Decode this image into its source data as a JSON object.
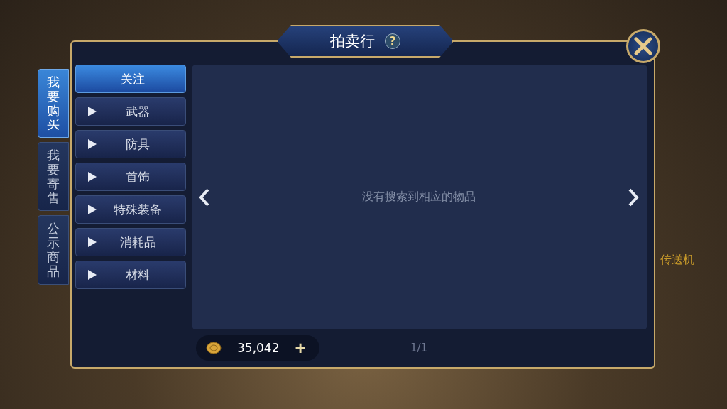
{
  "scene": {
    "label": "传送机"
  },
  "window": {
    "title": "拍卖行",
    "help": "?"
  },
  "side_tabs": [
    {
      "label": "我要购买",
      "selected": true
    },
    {
      "label": "我要寄售",
      "selected": false
    },
    {
      "label": "公示商品",
      "selected": false
    }
  ],
  "categories": [
    {
      "label": "关注",
      "kind": "plain",
      "selected": true
    },
    {
      "label": "武器",
      "kind": "group",
      "selected": false
    },
    {
      "label": "防具",
      "kind": "group",
      "selected": false
    },
    {
      "label": "首饰",
      "kind": "group",
      "selected": false
    },
    {
      "label": "特殊装备",
      "kind": "group",
      "selected": false
    },
    {
      "label": "消耗品",
      "kind": "group",
      "selected": false
    },
    {
      "label": "材料",
      "kind": "group",
      "selected": false
    }
  ],
  "results": {
    "empty_message": "没有搜索到相应的物品"
  },
  "currency": {
    "amount": "35,042",
    "add": "+"
  },
  "pager": {
    "page": "1/1"
  }
}
